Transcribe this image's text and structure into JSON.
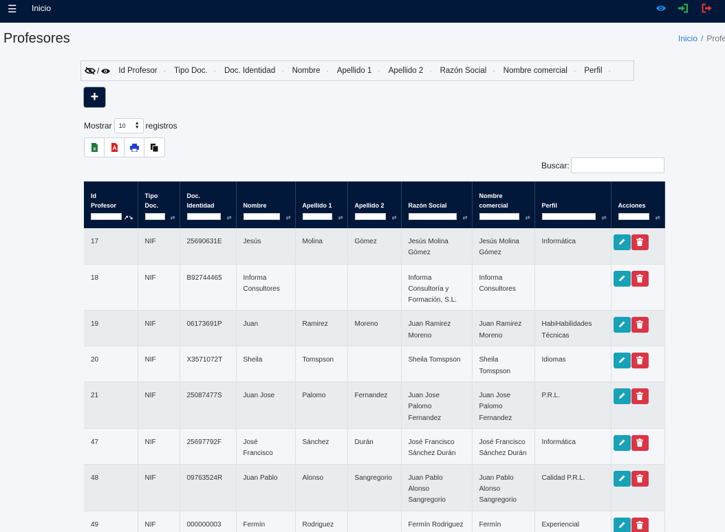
{
  "navbar": {
    "home_label": "Inicio"
  },
  "page": {
    "title": "Profesores"
  },
  "breadcrumb": {
    "home": "Inicio",
    "separator": "/",
    "current": "Profesores"
  },
  "column_toggle": {
    "slash": "/",
    "columns": [
      "Id Profesor",
      "Tipo Doc.",
      "Doc. Identidad",
      "Nombre",
      "Apellido 1",
      "Apellido 2",
      "Razón Social",
      "Nombre comercial",
      "Perfil"
    ],
    "dot": "·"
  },
  "add_button": {
    "label": "+"
  },
  "length": {
    "prefix": "Mostrar",
    "value": "10",
    "suffix": "registros"
  },
  "search": {
    "label": "Buscar:",
    "placeholder": ""
  },
  "table": {
    "headers": [
      [
        "Id",
        "Profesor"
      ],
      [
        "Tipo",
        "Doc."
      ],
      [
        "Doc.",
        "Identidad"
      ],
      [
        "",
        "Nombre"
      ],
      [
        "",
        "Apellido 1"
      ],
      [
        "",
        "Apellido 2"
      ],
      [
        "",
        "Razón Social"
      ],
      [
        "Nombre",
        "comercial"
      ],
      [
        "",
        "Perfil"
      ],
      [
        "",
        "Acciones"
      ]
    ],
    "rows": [
      [
        "17",
        "NIF",
        "25690631E",
        "Jesús",
        "Molina",
        "Gómez",
        "Jesús Molina Gómez",
        "Jesús Molina Gómez",
        "Informática"
      ],
      [
        "18",
        "NIF",
        "B92744465",
        "Informa Consultores",
        "",
        "",
        "Informa Consultoría y Formación, S.L.",
        "Informa Consultores",
        ""
      ],
      [
        "19",
        "NIF",
        "06173691P",
        "Juan",
        "Ramirez",
        "Moreno",
        "Juan Ramirez Moreno",
        "Juan Ramirez Moreno",
        "HabiHabilidades Técnicas"
      ],
      [
        "20",
        "NIF",
        "X3571072T",
        "Sheila",
        "Tomspson",
        "",
        "Sheila Tomspson",
        "Sheila Tomspson",
        "Idiomas"
      ],
      [
        "21",
        "NIF",
        "25087477S",
        "Juan Jose",
        "Palomo",
        "Fernandez",
        "Juan Jose Palomo Fernandez",
        "Juan Jose Palomo Fernandez",
        "P.R.L."
      ],
      [
        "47",
        "NIF",
        "25697792F",
        "José Francisco",
        "Sánchez",
        "Durán",
        "José Francisco Sánchez Durán",
        "José Francisco Sánchez Durán",
        "Informática"
      ],
      [
        "48",
        "NIF",
        "09763524R",
        "Juan Pablo",
        "Alonso",
        "Sangregorio",
        "Juan Pablo Alonso Sangregorio",
        "Juan Pablo Alonso Sangregorio",
        "Calidad P.R.L."
      ],
      [
        "49",
        "NIF",
        "000000003",
        "Fermín",
        "Rodriguez",
        "",
        "Fermín Rodriguez",
        "Fermín Rodriguez",
        "Experiencial"
      ]
    ]
  },
  "colors": {
    "navbar": "#02183a",
    "edit_button": "#17a2b8",
    "delete_button": "#dc3545",
    "eye_icon": "#1e88e5",
    "login_icon": "#22b14c",
    "logout_icon": "#e53935"
  }
}
